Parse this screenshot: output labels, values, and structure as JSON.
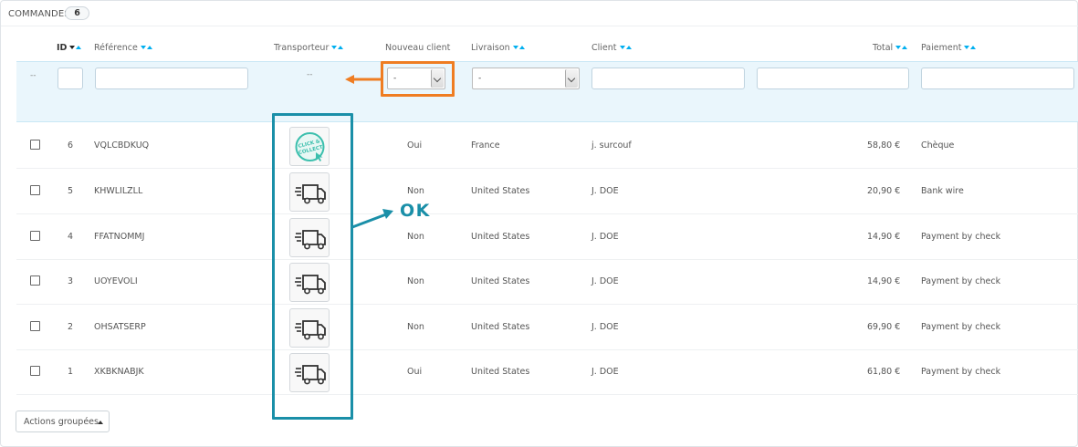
{
  "panel": {
    "title": "COMMANDES",
    "count": "6"
  },
  "columns": {
    "id": "ID",
    "reference": "Référence",
    "carrier": "Transporteur",
    "new_client": "Nouveau client",
    "delivery": "Livraison",
    "client": "Client",
    "total": "Total",
    "payment": "Paiement"
  },
  "filters": {
    "select_dash": "--",
    "carrier_dash": "--",
    "new_client_value": "-",
    "delivery_value": "-"
  },
  "orders": [
    {
      "id": "6",
      "reference": "VQLCBDKUQ",
      "carrier_icon": "click-and-collect-icon",
      "carrier_logo_text": "CLICK & COLLECT",
      "new_client": "Oui",
      "delivery": "France",
      "client": "j. surcouf",
      "total": "58,80 €",
      "payment": "Chèque"
    },
    {
      "id": "5",
      "reference": "KHWLILZLL",
      "carrier_icon": "delivery-truck-icon",
      "new_client": "Non",
      "delivery": "United States",
      "client": "J. DOE",
      "total": "20,90 €",
      "payment": "Bank wire"
    },
    {
      "id": "4",
      "reference": "FFATNOMMJ",
      "carrier_icon": "delivery-truck-icon",
      "new_client": "Non",
      "delivery": "United States",
      "client": "J. DOE",
      "total": "14,90 €",
      "payment": "Payment by check"
    },
    {
      "id": "3",
      "reference": "UOYEVOLI",
      "carrier_icon": "delivery-truck-icon",
      "new_client": "Non",
      "delivery": "United States",
      "client": "J. DOE",
      "total": "14,90 €",
      "payment": "Payment by check"
    },
    {
      "id": "2",
      "reference": "OHSATSERP",
      "carrier_icon": "delivery-truck-icon",
      "new_client": "Non",
      "delivery": "United States",
      "client": "J. DOE",
      "total": "69,90 €",
      "payment": "Payment by check"
    },
    {
      "id": "1",
      "reference": "XKBKNABJK",
      "carrier_icon": "delivery-truck-icon",
      "new_client": "Oui",
      "delivery": "United States",
      "client": "J. DOE",
      "total": "61,80 €",
      "payment": "Payment by check"
    }
  ],
  "annotation": {
    "ok_label": "OK"
  },
  "bulk_actions": {
    "label": "Actions groupées"
  },
  "colors": {
    "accent": "#00aff0",
    "filter_bg": "#eaf6fc",
    "annotation_orange": "#ef7d22",
    "annotation_teal": "#1a8fa8",
    "collect_green": "#3bbfad"
  }
}
